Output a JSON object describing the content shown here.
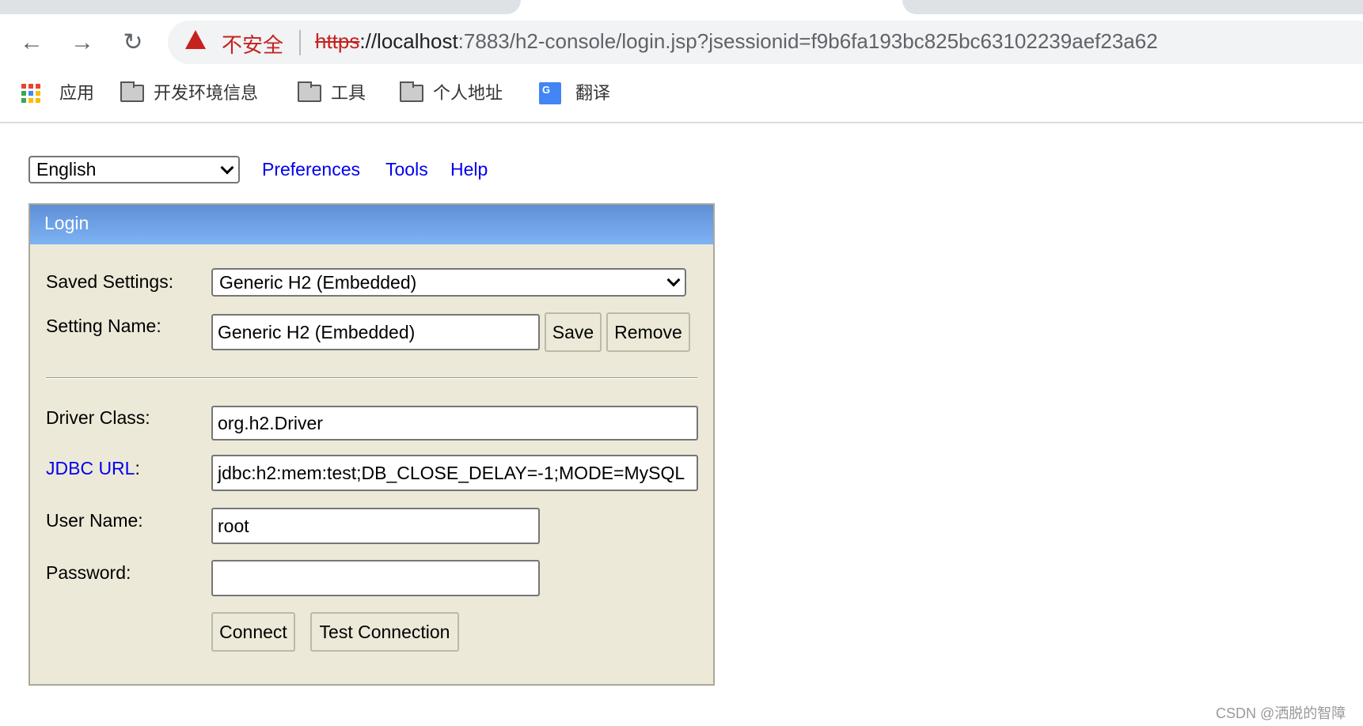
{
  "browser": {
    "security_label": "不安全",
    "url_scheme": "https",
    "url_rest_host": "://localhost",
    "url_rest_path": ":7883/h2-console/login.jsp?jsessionid=f9b6fa193bc825bc63102239aef23a62",
    "bookmarks": [
      {
        "label": "应用",
        "icon": "apps-grid-icon"
      },
      {
        "label": "开发环境信息",
        "icon": "folder-icon"
      },
      {
        "label": "工具",
        "icon": "folder-icon"
      },
      {
        "label": "个人地址",
        "icon": "folder-icon"
      },
      {
        "label": "翻译",
        "icon": "google-translate-icon"
      }
    ]
  },
  "topbar": {
    "language": "English",
    "links": [
      "Preferences",
      "Tools",
      "Help"
    ]
  },
  "login": {
    "title": "Login",
    "saved_settings_label": "Saved Settings:",
    "saved_settings_value": "Generic H2 (Embedded)",
    "setting_name_label": "Setting Name:",
    "setting_name_value": "Generic H2 (Embedded)",
    "save": "Save",
    "remove": "Remove",
    "driver_class_label": "Driver Class:",
    "driver_class_value": "org.h2.Driver",
    "jdbc_url_label": "JDBC URL",
    "jdbc_url_colon": ":",
    "jdbc_url_value": "jdbc:h2:mem:test;DB_CLOSE_DELAY=-1;MODE=MySQL",
    "user_name_label": "User Name:",
    "user_name_value": "root",
    "password_label": "Password:",
    "password_value": "",
    "connect": "Connect",
    "test_connection": "Test Connection"
  },
  "watermark": "CSDN @洒脱的智障",
  "colors": {
    "link": "#0000ee",
    "header_start": "#5e8fd6",
    "header_end": "#7eb3f4",
    "panel_bg": "#ece9d8",
    "warning": "#c5221f"
  }
}
